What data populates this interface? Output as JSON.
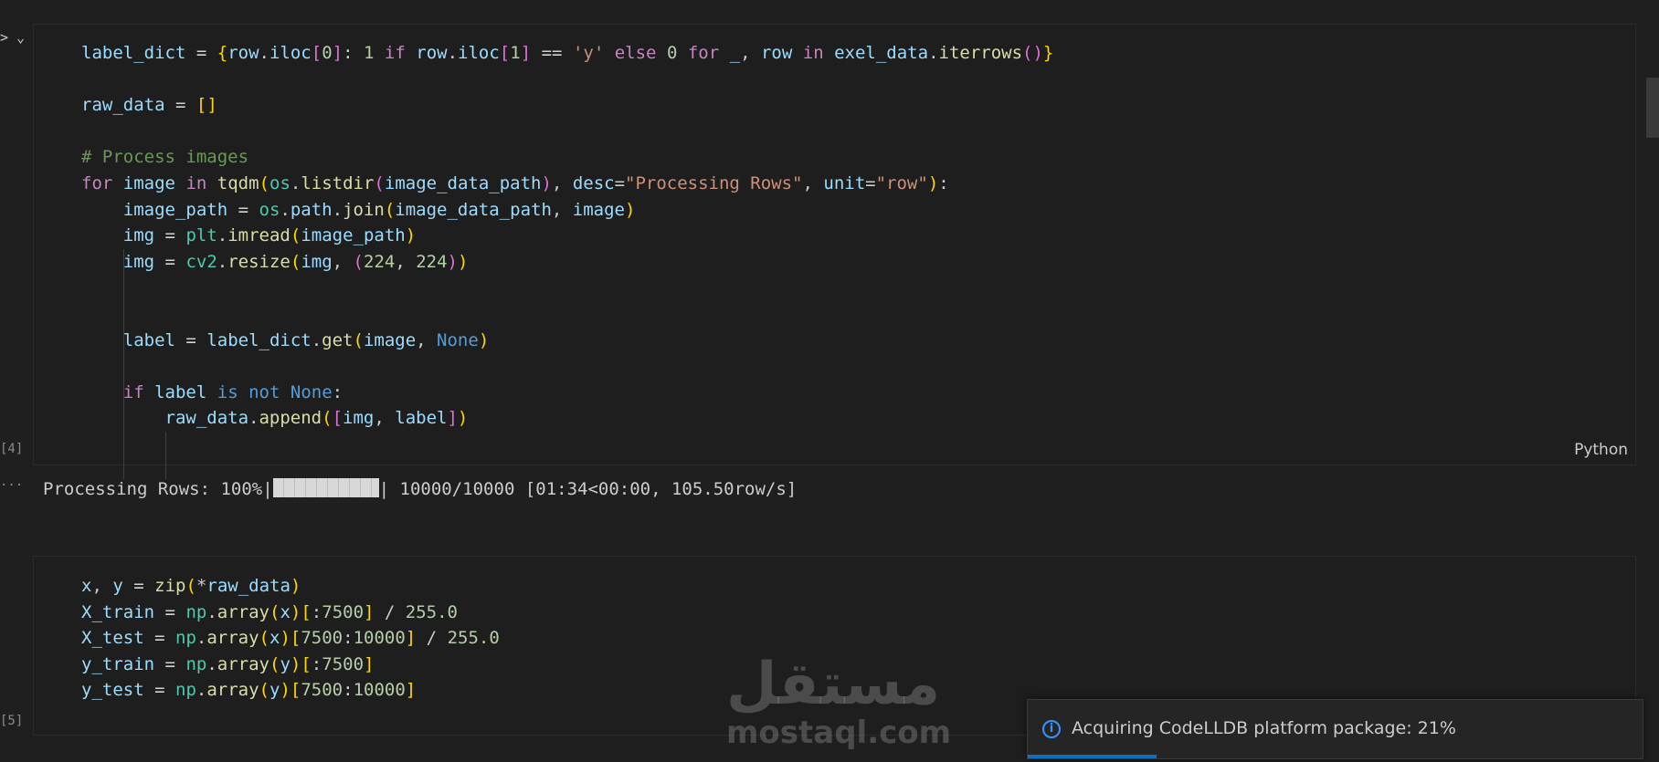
{
  "cell1": {
    "execution_count": "[4]",
    "language": "Python",
    "lines": [
      "label_dict = {row.iloc[0]: 1 if row.iloc[1] == 'y' else 0 for _, row in exel_data.iterrows()}",
      "",
      "raw_data = []",
      "",
      "# Process images",
      "for image in tqdm(os.listdir(image_data_path), desc=\"Processing Rows\", unit=\"row\"):",
      "    image_path = os.path.join(image_data_path, image)",
      "    img = plt.imread(image_path)",
      "    img = cv2.resize(img, (224, 224))",
      "",
      "",
      "    label = label_dict.get(image, None)",
      "",
      "    if label is not None:",
      "        raw_data.append([img, label])"
    ]
  },
  "output1": {
    "prefix": "Processing Rows: 100%|",
    "suffix": "| 10000/10000 [01:34<00:00, 105.50row/s]",
    "more_glyph": "···"
  },
  "cell2": {
    "execution_count": "[5]",
    "lines": [
      "x, y = zip(*raw_data)",
      "X_train = np.array(x)[:7500] / 255.0",
      "X_test = np.array(x)[7500:10000] / 255.0",
      "y_train = np.array(y)[:7500]",
      "y_test = np.array(y)[7500:10000]"
    ]
  },
  "toast": {
    "message": "Acquiring CodeLLDB platform package: 21%",
    "icon": "info-icon",
    "progress": 0.21
  },
  "watermark": {
    "arabic": "مستقل",
    "latin": "mostaql.com"
  },
  "colors": {
    "keyword": "#c586c0",
    "variable": "#9cdcfe",
    "function": "#dcdcaa",
    "string": "#ce9178",
    "number": "#b5cea8",
    "comment": "#6a9955",
    "constant": "#569cd6"
  }
}
